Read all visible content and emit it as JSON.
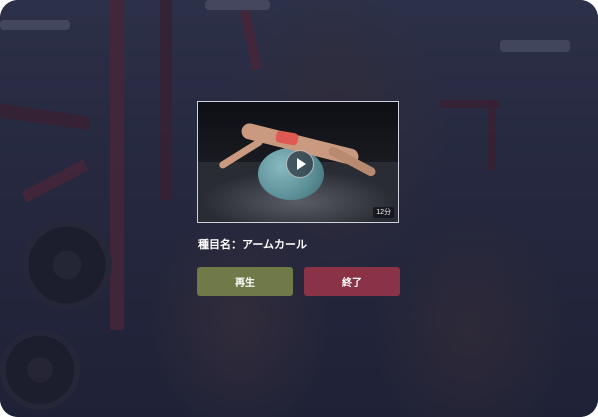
{
  "dialog": {
    "exercise_label": "種目名：アームカール",
    "play_button": "再生",
    "end_button": "終了"
  },
  "video": {
    "duration": "12分",
    "play_icon": "play-icon"
  },
  "colors": {
    "play_button_bg": "#6f7a48",
    "end_button_bg": "#8a3246",
    "overlay": "#1c1e34"
  }
}
